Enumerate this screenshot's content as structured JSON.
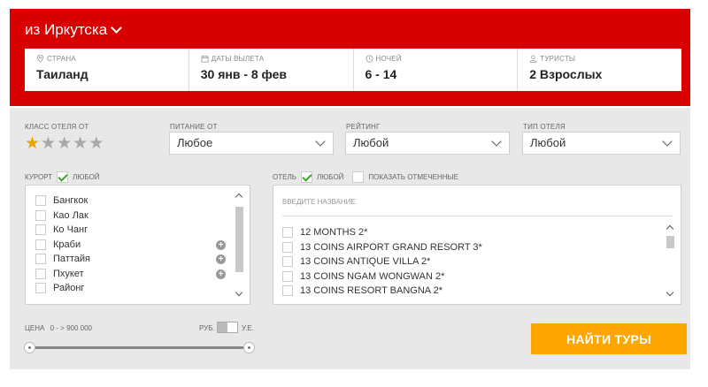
{
  "departure": {
    "city": "из Иркутска"
  },
  "summary": {
    "country": {
      "label": "СТРАНА",
      "value": "Таиланд"
    },
    "dates": {
      "label": "ДАТЫ ВЫЛЕТА",
      "value": "30 янв - 8 фев"
    },
    "nights": {
      "label": "НОЧЕЙ",
      "value": "6 - 14"
    },
    "tourists": {
      "label": "ТУРИСТЫ",
      "value": "2 Взрослых"
    }
  },
  "filters": {
    "hotel_class": {
      "label": "КЛАСС ОТЕЛЯ ОТ",
      "rating": 1,
      "max": 5
    },
    "meals": {
      "label": "ПИТАНИЕ ОТ",
      "value": "Любое"
    },
    "rating": {
      "label": "РЕЙТИНГ",
      "value": "Любой"
    },
    "hotel_type": {
      "label": "ТИП ОТЕЛЯ",
      "value": "Любой"
    }
  },
  "resort": {
    "label": "КУРОРТ",
    "any_label": "ЛЮБОЙ",
    "any_checked": true,
    "items": [
      {
        "name": "Бангкок",
        "expandable": false
      },
      {
        "name": "Као Лак",
        "expandable": false
      },
      {
        "name": "Ко Чанг",
        "expandable": false
      },
      {
        "name": "Краби",
        "expandable": true
      },
      {
        "name": "Паттайя",
        "expandable": true
      },
      {
        "name": "Пхукет",
        "expandable": true
      },
      {
        "name": "Районг",
        "expandable": false
      }
    ]
  },
  "hotel": {
    "label": "ОТЕЛЬ",
    "any_label": "ЛЮБОЙ",
    "any_checked": true,
    "show_marked_label": "ПОКАЗАТЬ ОТМЕЧЕННЫЕ",
    "show_marked_checked": false,
    "search_placeholder": "ВВЕДИТЕ НАЗВАНИЕ",
    "items": [
      "12 MONTHS 2*",
      "13 COINS AIRPORT GRAND RESORT 3*",
      "13 COINS ANTIQUE VILLA 2*",
      "13 COINS NGAM WONGWAN 2*",
      "13 COINS RESORT BANGNA 2*"
    ]
  },
  "price": {
    "label": "ЦЕНА",
    "range": "0 -  > 900 000",
    "currency_left": "РУБ.",
    "currency_right": "У.Е.",
    "min_fraction": 0.0,
    "max_fraction": 1.0
  },
  "search_button": {
    "label": "НАЙТИ ТУРЫ"
  },
  "colors": {
    "header": "#d90000",
    "button": "#ffa500",
    "check": "#3ea52b",
    "star": "#e3a500"
  }
}
